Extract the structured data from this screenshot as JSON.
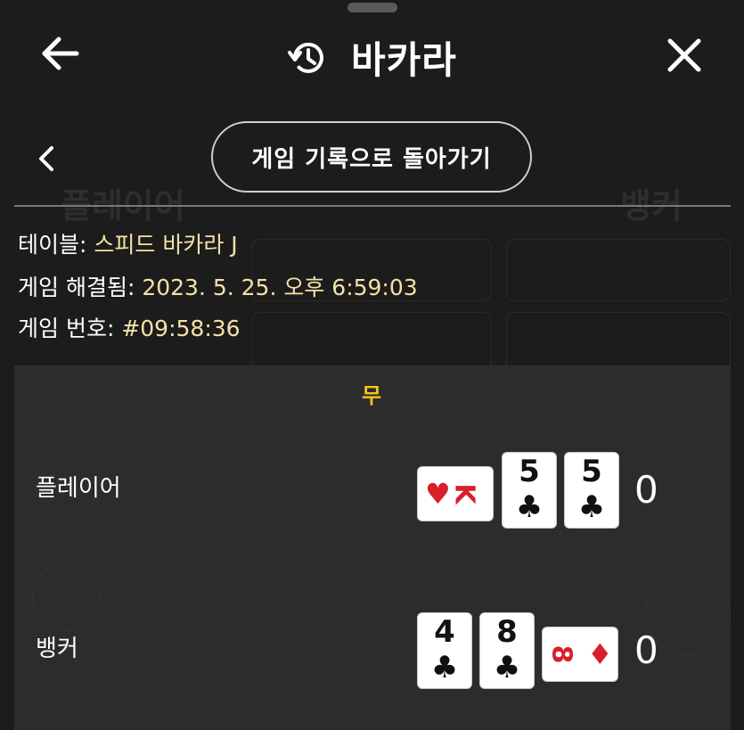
{
  "header": {
    "title": "바카라",
    "back_icon": "arrow-left-icon",
    "history_icon": "history-icon",
    "close_icon": "close-icon"
  },
  "nav": {
    "back_to_history_label": "게임 기록으로 돌아가기",
    "prev_icon": "chevron-left-icon"
  },
  "info": {
    "table_label": "테이블:",
    "table_value": "스피드 바카라 J",
    "resolved_label": "게임 해결됨:",
    "resolved_value": "2023. 5. 25. 오후 6:59:03",
    "game_number_label": "게임 번호:",
    "game_number_value": "#09:58:36"
  },
  "result": {
    "outcome": "무",
    "outcome_color": "#f5c518",
    "player": {
      "label": "플레이어",
      "score": "0",
      "cards": [
        {
          "rank": "K",
          "suit": "♥",
          "color": "red",
          "orientation": "horizontal"
        },
        {
          "rank": "5",
          "suit": "♣",
          "color": "black",
          "orientation": "vertical"
        },
        {
          "rank": "5",
          "suit": "♣",
          "color": "black",
          "orientation": "vertical"
        }
      ]
    },
    "banker": {
      "label": "뱅커",
      "score": "0",
      "cards": [
        {
          "rank": "4",
          "suit": "♣",
          "color": "black",
          "orientation": "vertical"
        },
        {
          "rank": "8",
          "suit": "♣",
          "color": "black",
          "orientation": "vertical"
        },
        {
          "rank": "8",
          "suit": "♦",
          "color": "red",
          "orientation": "horizontal"
        }
      ]
    }
  },
  "colors": {
    "background": "#1c1c1c",
    "info_value": "#f3e2a6",
    "card_red": "#d81f2a"
  }
}
